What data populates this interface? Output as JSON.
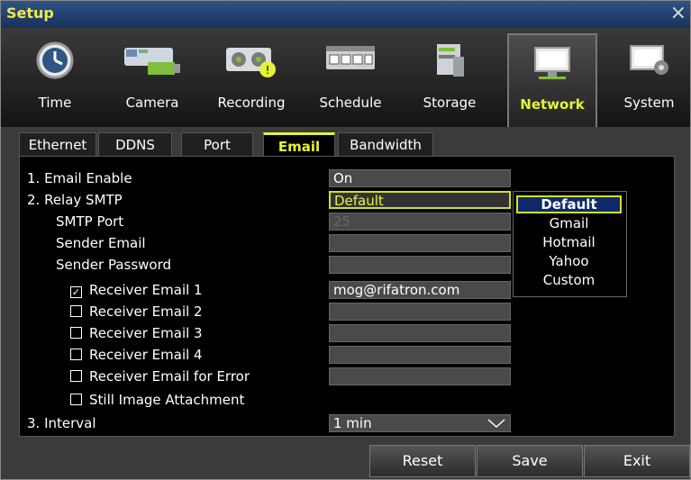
{
  "window": {
    "title": "Setup",
    "close_glyph": "×"
  },
  "iconbar": [
    {
      "label": "Time",
      "icon": "clock-icon"
    },
    {
      "label": "Camera",
      "icon": "camera-icon"
    },
    {
      "label": "Recording",
      "icon": "recording-icon"
    },
    {
      "label": "Schedule",
      "icon": "schedule-icon"
    },
    {
      "label": "Storage",
      "icon": "storage-icon"
    },
    {
      "label": "Network",
      "icon": "monitor-icon",
      "selected": true
    },
    {
      "label": "System",
      "icon": "system-icon"
    }
  ],
  "tabs": [
    {
      "label": "Ethernet"
    },
    {
      "label": "DDNS"
    },
    {
      "label": "Port"
    },
    {
      "label": "Email",
      "selected": true
    },
    {
      "label": "Bandwidth"
    }
  ],
  "form": {
    "email_enable": {
      "label": "1. Email Enable",
      "value": "On"
    },
    "relay_smtp": {
      "label": "2. Relay SMTP",
      "value": "Default"
    },
    "smtp_port": {
      "label": "SMTP Port",
      "value": "25"
    },
    "sender_email": {
      "label": "Sender Email",
      "value": ""
    },
    "sender_password": {
      "label": "Sender Password",
      "value": ""
    },
    "receiver1": {
      "label": "Receiver Email 1",
      "value": "mog@rifatron.com",
      "checked": true,
      "check_glyph": "✓"
    },
    "receiver2": {
      "label": "Receiver Email 2",
      "value": "",
      "checked": false
    },
    "receiver3": {
      "label": "Receiver Email 3",
      "value": "",
      "checked": false
    },
    "receiver4": {
      "label": "Receiver Email 4",
      "value": "",
      "checked": false
    },
    "receiver_error": {
      "label": "Receiver Email for Error",
      "value": "",
      "checked": false
    },
    "still_image": {
      "label": "Still Image Attachment",
      "checked": false
    },
    "interval": {
      "label": "3. Interval",
      "value": "1 min"
    }
  },
  "smtp_dropdown": {
    "options": [
      "Default",
      "Gmail",
      "Hotmail",
      "Yahoo",
      "Custom"
    ],
    "selected": "Default"
  },
  "buttons": {
    "reset": "Reset",
    "save": "Save",
    "exit": "Exit"
  },
  "colors": {
    "accent": "#e6f23a",
    "titlebar": "#1f3d6b",
    "panel": "#000000"
  }
}
